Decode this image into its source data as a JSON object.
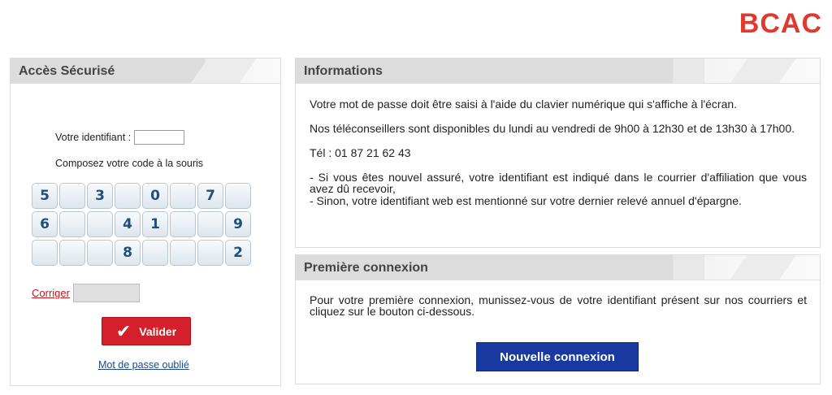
{
  "brand": {
    "logo_text": "BCAC",
    "logo_color": "#e03a2f"
  },
  "secure_panel": {
    "title": "Accès Sécurisé",
    "id_label": "Votre identifiant :",
    "id_value": "",
    "compose_label": "Composez votre code à la souris",
    "keypad": [
      [
        "5",
        "",
        "3",
        "",
        "0",
        "",
        "7",
        ""
      ],
      [
        "6",
        "",
        "",
        "4",
        "1",
        "",
        "",
        "9"
      ],
      [
        "",
        "",
        "",
        "8",
        "",
        "",
        "",
        "2"
      ]
    ],
    "corriger_label": "Corriger",
    "code_value": "",
    "valider_label": "Valider",
    "forgot_label": "Mot de passe oublié"
  },
  "info_panel": {
    "title": "Informations",
    "p1": "Votre mot de passe doit être saisi à l'aide du clavier numérique qui s'affiche à l'écran.",
    "p2": "Nos téléconseillers sont disponibles du lundi au vendredi de 9h00 à 12h30 et de 13h30 à 17h00.",
    "p3": "Tél : 01 87 21 62 43",
    "p4": "- Si vous êtes nouvel assuré, votre identifiant est indiqué dans le courrier d'affiliation que vous avez dû recevoir,",
    "p5": "- Sinon, votre identifiant web est mentionné sur votre dernier relevé annuel d'épargne."
  },
  "first_panel": {
    "title": "Première connexion",
    "p1": "Pour votre première connexion, munissez-vous de votre identifiant présent sur nos courriers et cliquez sur le bouton ci-dessous.",
    "button_label": "Nouvelle connexion"
  },
  "colors": {
    "valider_red": "#d4202a",
    "nouvelle_blue": "#183aa0",
    "key_text": "#1f4f7a"
  }
}
